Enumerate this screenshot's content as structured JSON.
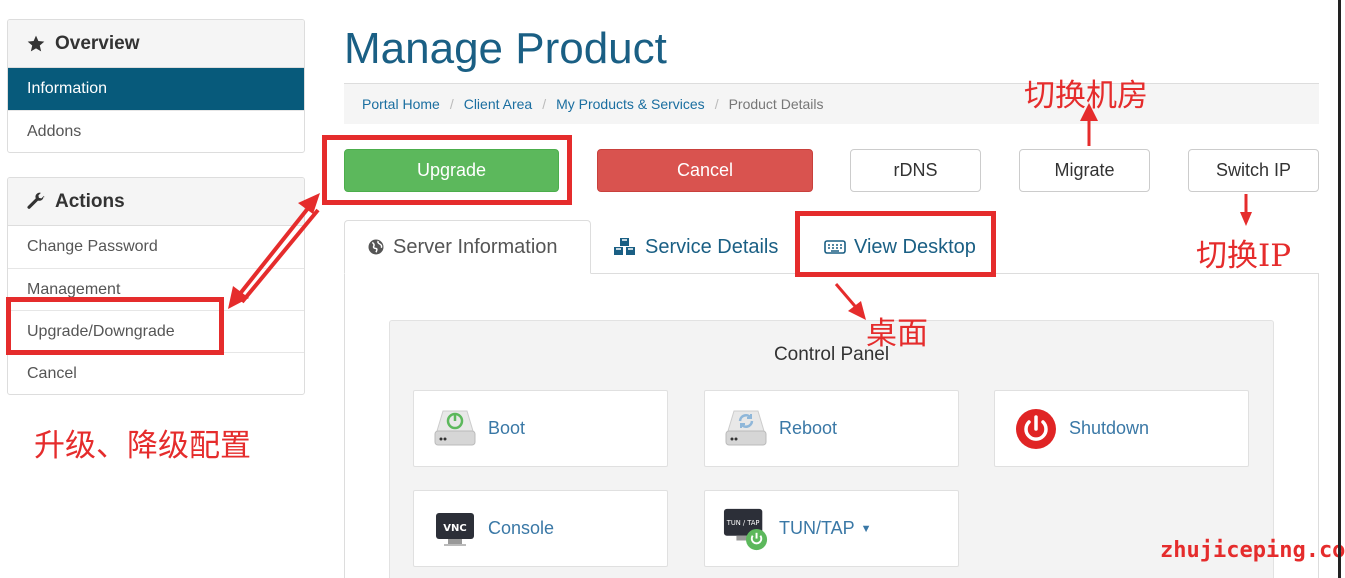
{
  "sidebar": {
    "overview_title": "Overview",
    "overview_items": [
      {
        "label": "Information"
      },
      {
        "label": "Addons"
      }
    ],
    "actions_title": "Actions",
    "actions_items": [
      {
        "label": "Change Password"
      },
      {
        "label": "Management"
      },
      {
        "label": "Upgrade/Downgrade"
      },
      {
        "label": "Cancel"
      }
    ]
  },
  "page_title": "Manage Product",
  "breadcrumb": [
    "Portal Home",
    "Client Area",
    "My Products & Services",
    "Product Details"
  ],
  "buttons": {
    "upgrade": "Upgrade",
    "cancel": "Cancel",
    "rdns": "rDNS",
    "migrate": "Migrate",
    "switch_ip": "Switch IP"
  },
  "tabs": [
    {
      "label": "Server Information"
    },
    {
      "label": "Service Details"
    },
    {
      "label": "View Desktop"
    }
  ],
  "control_panel": {
    "title": "Control Panel",
    "items": [
      {
        "label": "Boot",
        "icon": "boot-icon"
      },
      {
        "label": "Reboot",
        "icon": "reboot-icon"
      },
      {
        "label": "Shutdown",
        "icon": "power-icon"
      },
      {
        "label": "Console",
        "icon": "vnc-icon",
        "icon_text": "VNC"
      },
      {
        "label": "TUN/TAP",
        "icon": "tun-tap-icon",
        "icon_text": "TUN / TAP"
      }
    ]
  },
  "annotations": {
    "migrate_note": "切换机房",
    "switch_ip_note": "切换IP",
    "desktop_note": "桌面",
    "upgrade_note": "升级、降级配置"
  },
  "watermark": "zhujiceping.com",
  "colors": {
    "accent": "#075a7b",
    "title": "#1a5f84",
    "success": "#5cb85c",
    "danger": "#d9534f",
    "annotation": "#e52c2c"
  }
}
